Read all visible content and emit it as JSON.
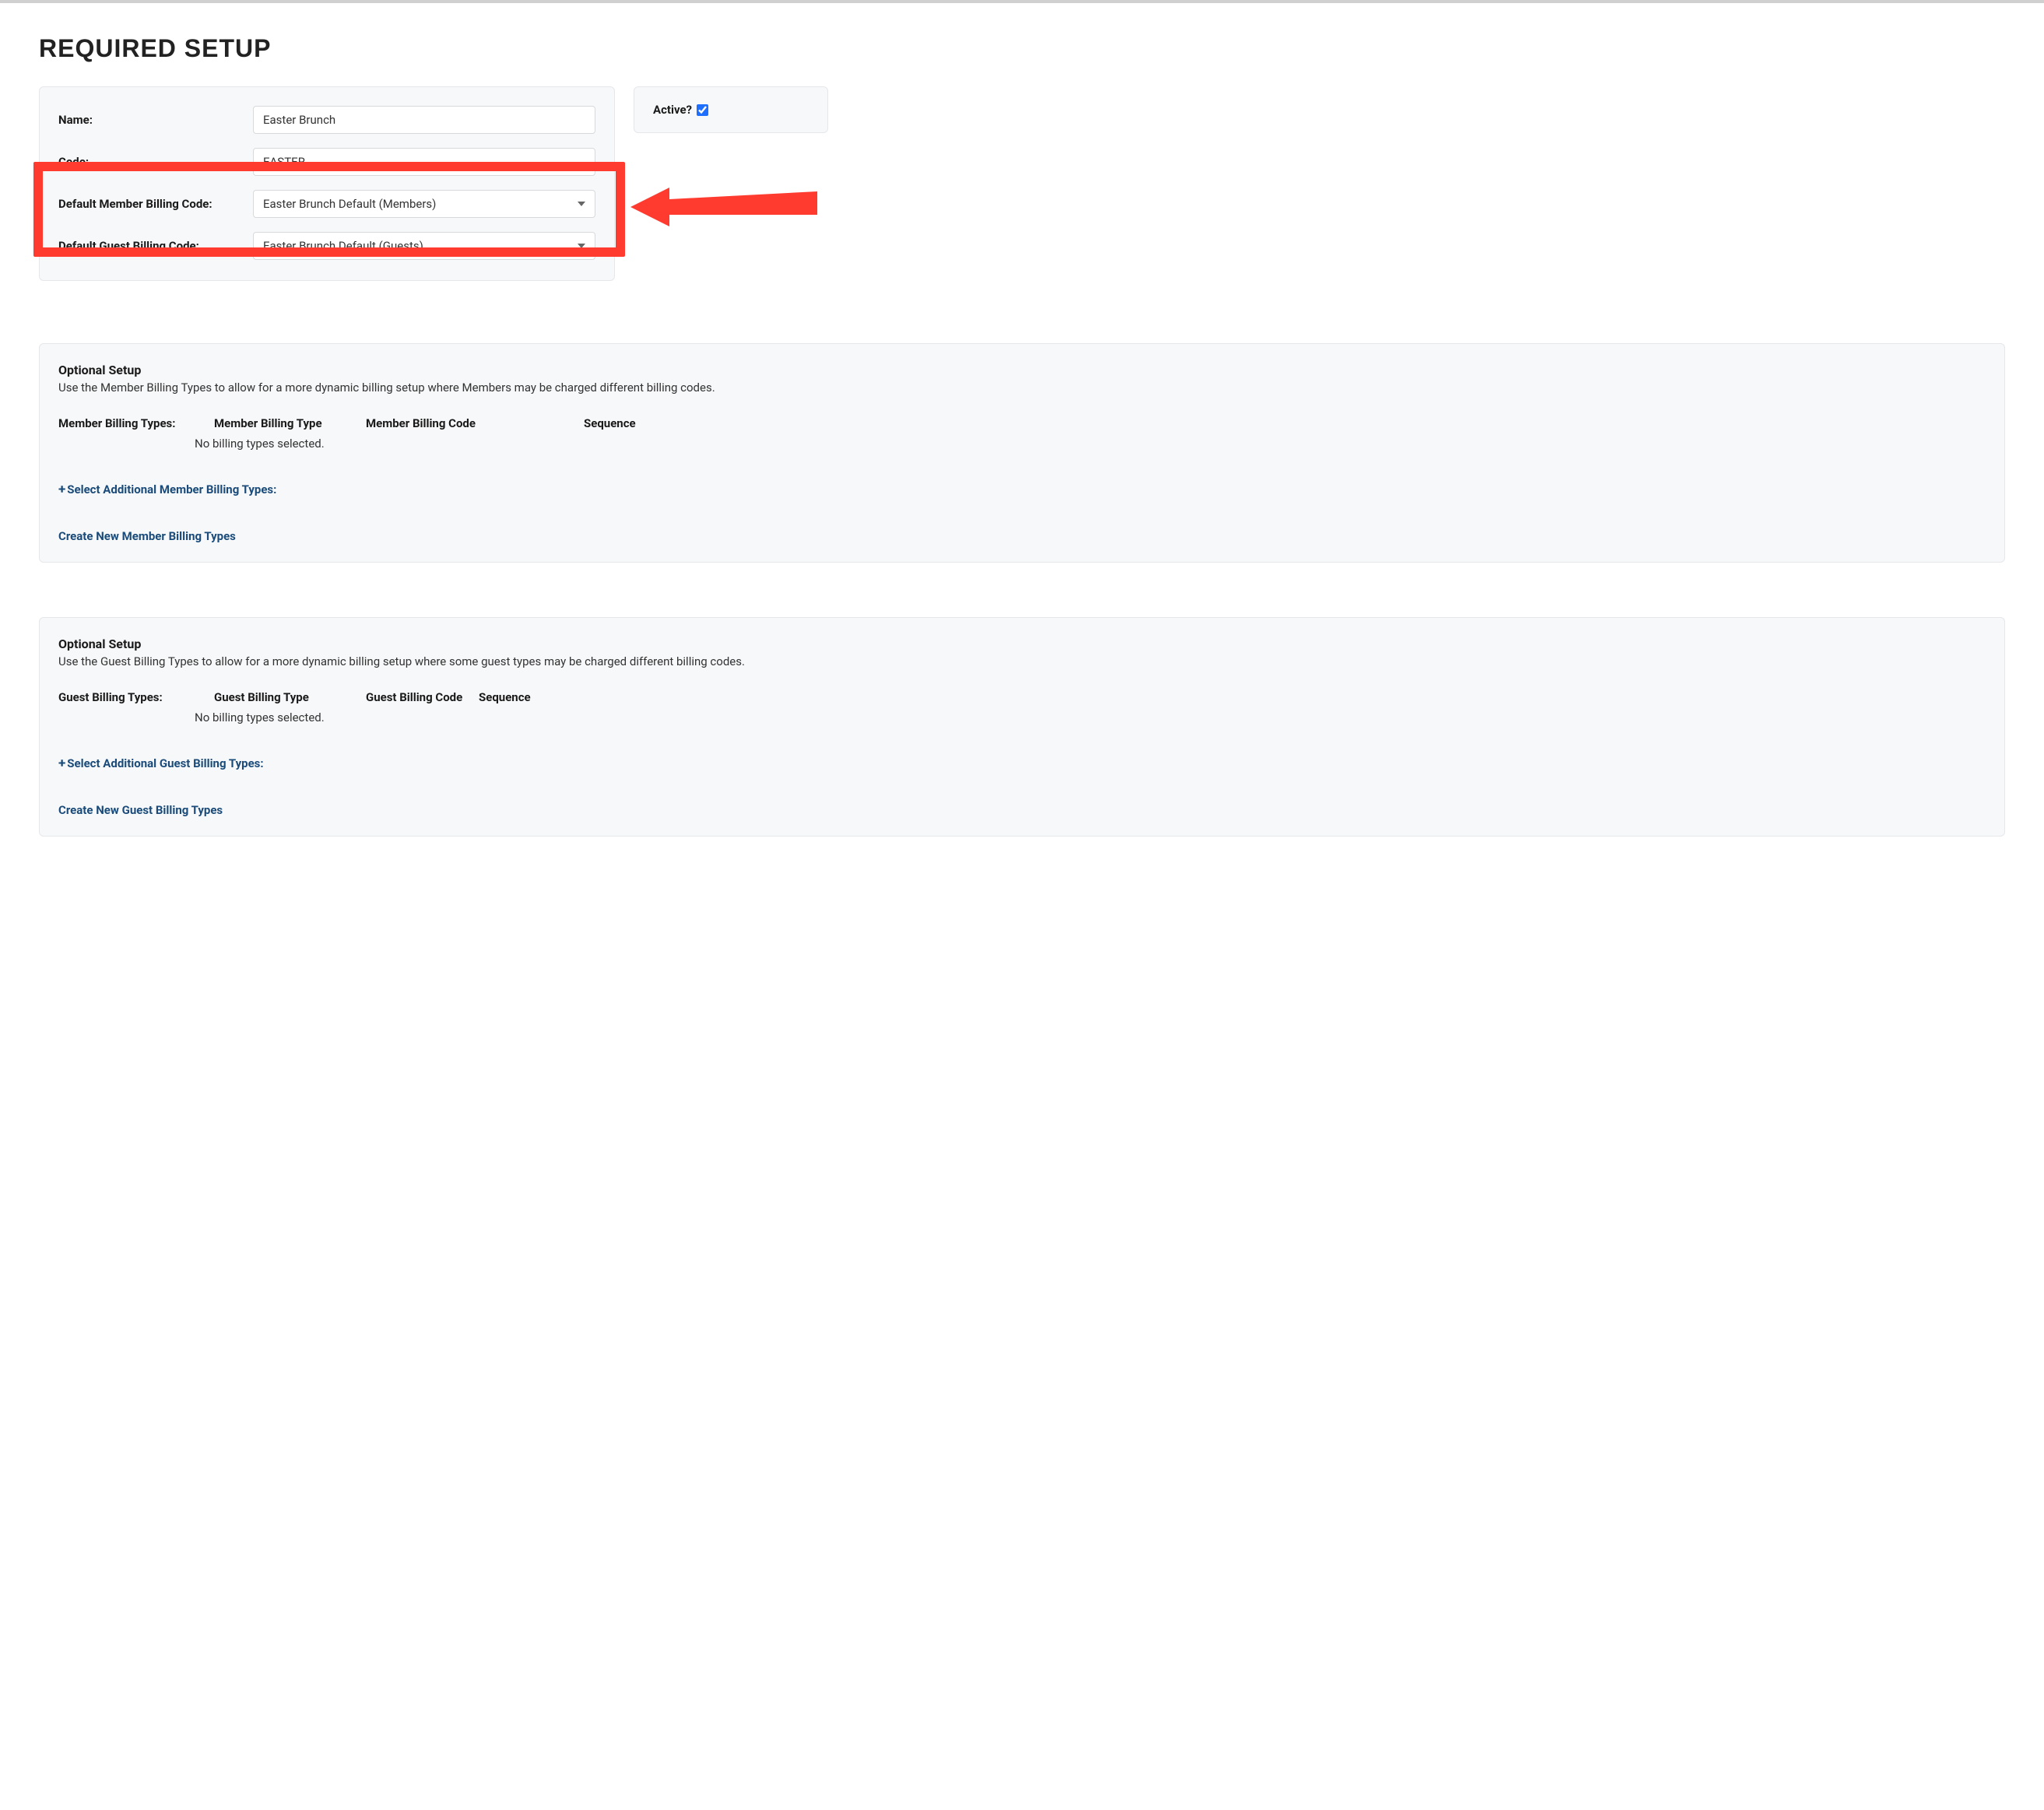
{
  "page": {
    "title": "REQUIRED SETUP"
  },
  "form": {
    "name_label": "Name:",
    "name_value": "Easter Brunch",
    "code_label": "Code:",
    "code_value": "EASTER",
    "member_code_label": "Default Member Billing Code:",
    "member_code_value": "Easter Brunch Default (Members)",
    "guest_code_label": "Default Guest Billing Code:",
    "guest_code_value": "Easter Brunch Default (Guests)"
  },
  "active": {
    "label": "Active?",
    "checked": true
  },
  "member_section": {
    "title": "Optional Setup",
    "description": "Use the Member Billing Types to allow for a more dynamic billing setup where Members may be charged different billing codes.",
    "types_label": "Member Billing Types:",
    "col_type": "Member Billing Type",
    "col_code": "Member Billing Code",
    "col_seq": "Sequence",
    "empty": "No billing types selected.",
    "select_link": "Select Additional Member Billing Types:",
    "create_link": "Create New Member Billing Types"
  },
  "guest_section": {
    "title": "Optional Setup",
    "description": "Use the Guest Billing Types to allow for a more dynamic billing setup where some guest types may be charged different billing codes.",
    "types_label": "Guest Billing Types:",
    "col_type": "Guest Billing Type",
    "col_code": "Guest Billing Code",
    "col_seq": "Sequence",
    "empty": "No billing types selected.",
    "select_link": "Select Additional Guest Billing Types:",
    "create_link": "Create New Guest Billing Types"
  },
  "annotation": {
    "highlight_color": "#ff3b2f",
    "arrow_color": "#ff3b2f"
  }
}
